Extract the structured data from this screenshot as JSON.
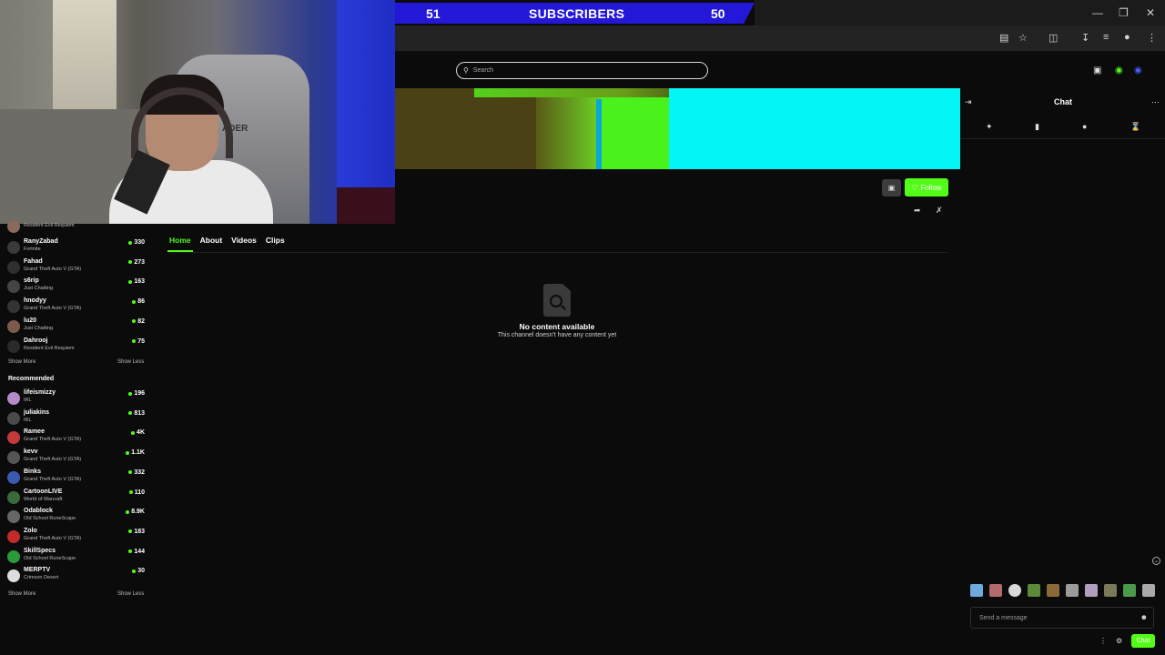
{
  "overlay": {
    "sub_left": "51",
    "sub_label": "SUBSCRIBERS",
    "sub_right": "50",
    "chair_text": "ADER"
  },
  "search": {
    "placeholder": "Search"
  },
  "channel": {
    "follow_label": "Follow"
  },
  "tabs": [
    "Home",
    "About",
    "Videos",
    "Clips"
  ],
  "empty_state": {
    "title": "No content available",
    "subtitle": "This channel doesn't have any content yet"
  },
  "chat": {
    "title": "Chat",
    "input_placeholder": "Send a message",
    "send_label": "Chat"
  },
  "sidebar": {
    "following_top_game": "Resident Evil Requiem",
    "following": [
      {
        "name": "RanyZabad",
        "game": "Fortnite",
        "viewers": "330"
      },
      {
        "name": "Fahad",
        "game": "Grand Theft Auto V (GTA)",
        "viewers": "273"
      },
      {
        "name": "s6rip",
        "game": "Just Chatting",
        "viewers": "163"
      },
      {
        "name": "hnodyy",
        "game": "Grand Theft Auto V (GTA)",
        "viewers": "86"
      },
      {
        "name": "lu20",
        "game": "Just Chatting",
        "viewers": "82"
      },
      {
        "name": "Dahrooj",
        "game": "Resident Evil Requiem",
        "viewers": "75"
      }
    ],
    "show_more": "Show More",
    "show_less": "Show Less",
    "recommended_title": "Recommended",
    "recommended": [
      {
        "name": "lifeismizzy",
        "game": "IRL",
        "viewers": "196"
      },
      {
        "name": "juliakins",
        "game": "IRL",
        "viewers": "813"
      },
      {
        "name": "Ramee",
        "game": "Grand Theft Auto V (GTA)",
        "viewers": "4K"
      },
      {
        "name": "kevv",
        "game": "Grand Theft Auto V (GTA)",
        "viewers": "1.1K"
      },
      {
        "name": "Binks",
        "game": "Grand Theft Auto V (GTA)",
        "viewers": "332"
      },
      {
        "name": "CartoonLIVE",
        "game": "World of Warcraft",
        "viewers": "110"
      },
      {
        "name": "Odablock",
        "game": "Old School RuneScape",
        "viewers": "8.9K"
      },
      {
        "name": "Zolo",
        "game": "Grand Theft Auto V (GTA)",
        "viewers": "183"
      },
      {
        "name": "SkillSpecs",
        "game": "Old School RuneScape",
        "viewers": "144"
      },
      {
        "name": "MERPTV",
        "game": "Crimson Desert",
        "viewers": "30"
      }
    ]
  },
  "colors": {
    "accent": "#53fc18",
    "subscriber_bar": "#2418d8",
    "background": "#0b0b0c"
  }
}
